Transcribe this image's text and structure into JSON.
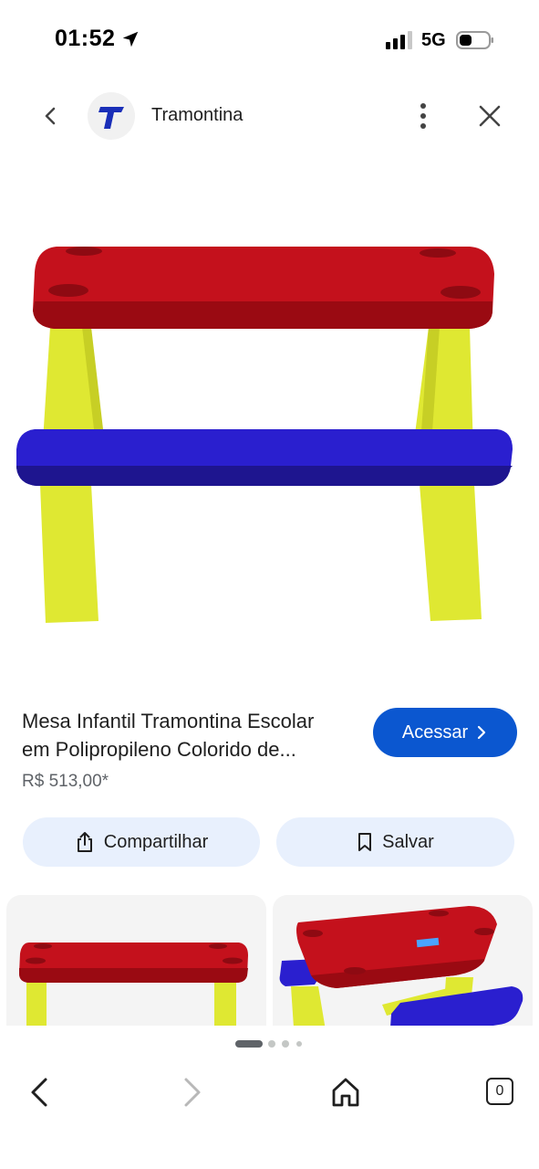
{
  "status_bar": {
    "time": "01:52",
    "network": "5G"
  },
  "header": {
    "site_name": "Tramontina",
    "logo_letter": "T"
  },
  "product": {
    "title_line1": "Mesa Infantil Tramontina Escolar",
    "title_line2": "em Polipropileno Colorido de...",
    "price": "R$ 513,00*",
    "access_label": "Acessar",
    "share_label": "Compartilhar",
    "save_label": "Salvar"
  },
  "toolbar": {
    "tabs_count": "0"
  },
  "colors": {
    "accent": "#0b57d0",
    "chip_bg": "#e8f0fd",
    "table_red": "#c4111c",
    "bench_blue": "#2a1fcf",
    "leg_yellow": "#dfe832"
  },
  "icons": [
    "location-arrow-icon",
    "signal-icon",
    "battery-icon",
    "back-chevron-icon",
    "more-vert-icon",
    "close-icon",
    "chevron-right-icon",
    "share-icon",
    "bookmark-icon",
    "back-arrow-icon",
    "forward-arrow-icon",
    "home-icon",
    "tabs-icon"
  ]
}
